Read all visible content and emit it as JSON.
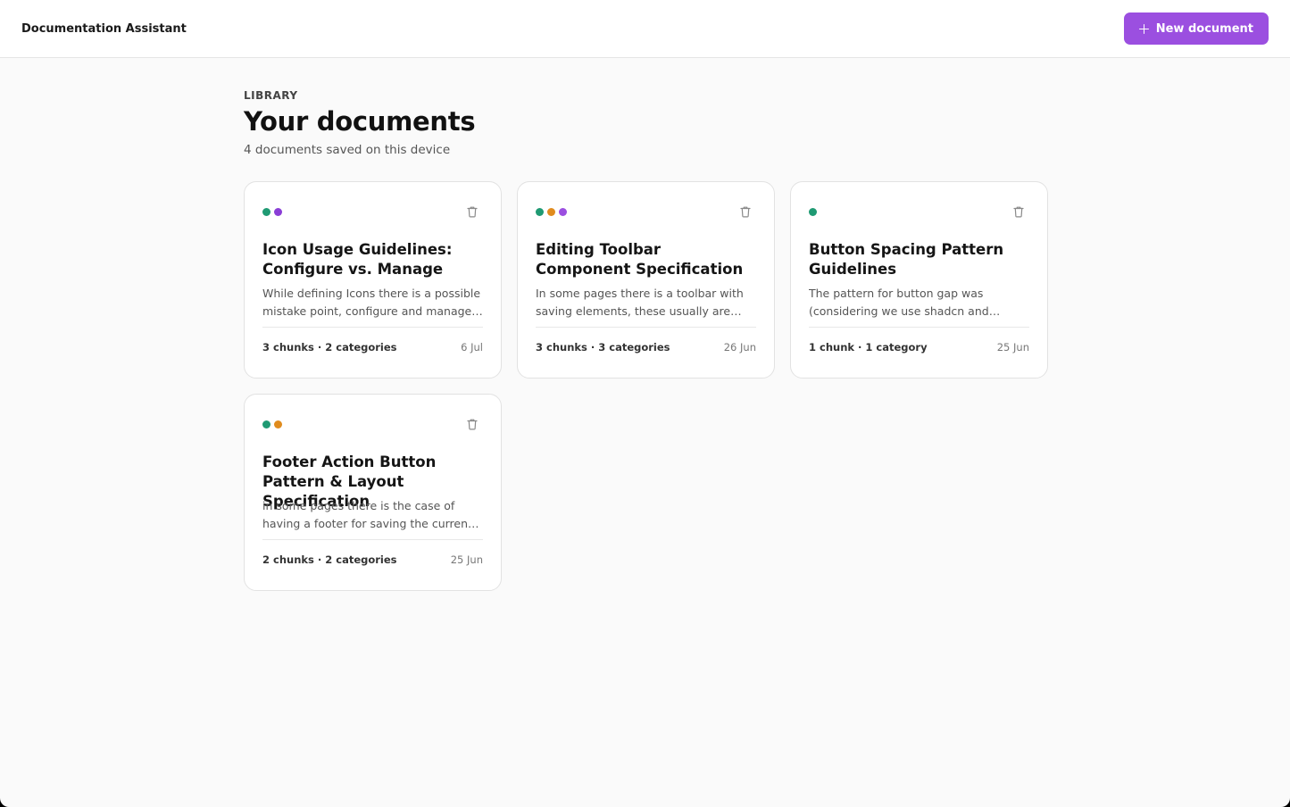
{
  "header": {
    "app_title": "Documentation Assistant",
    "new_document_label": "New document"
  },
  "library": {
    "eyebrow": "LIBRARY",
    "title": "Your documents",
    "subtitle": "4 documents saved on this device"
  },
  "colors": {
    "accent": "#9b4fe0",
    "green": "#1f9a73",
    "purple": "#8a3ed6",
    "orange": "#e08c1e"
  },
  "documents": [
    {
      "title": "Icon Usage Guidelines: Configure vs. Manage",
      "description": "While defining Icons there is a possible mistake point, configure and manage. Make sure to use the right icon.",
      "meta": "3 chunks · 2 categories",
      "date": "6 Jul",
      "tags": [
        "#1f9a73",
        "#8a3ed6"
      ]
    },
    {
      "title": "Editing Toolbar Component Specification",
      "description": "In some pages there is a toolbar with saving elements, these usually are placed at the top of the page.",
      "meta": "3 chunks · 3 categories",
      "date": "26 Jun",
      "tags": [
        "#1f9a73",
        "#e08c1e",
        "#9b4fe0"
      ]
    },
    {
      "title": "Button Spacing Pattern Guidelines",
      "description": "The pattern for button gap was (considering we use shadcn and tailwind classes) consistent across pages.",
      "meta": "1 chunk · 1 category",
      "date": "25 Jun",
      "tags": [
        "#1f9a73"
      ]
    },
    {
      "title": "Footer Action Button Pattern & Layout Specification",
      "description": "in some pages there is the case of having a footer for saving the current state of the form.",
      "meta": "2 chunks · 2 categories",
      "date": "25 Jun",
      "tags": [
        "#1f9a73",
        "#e08c1e"
      ]
    }
  ]
}
